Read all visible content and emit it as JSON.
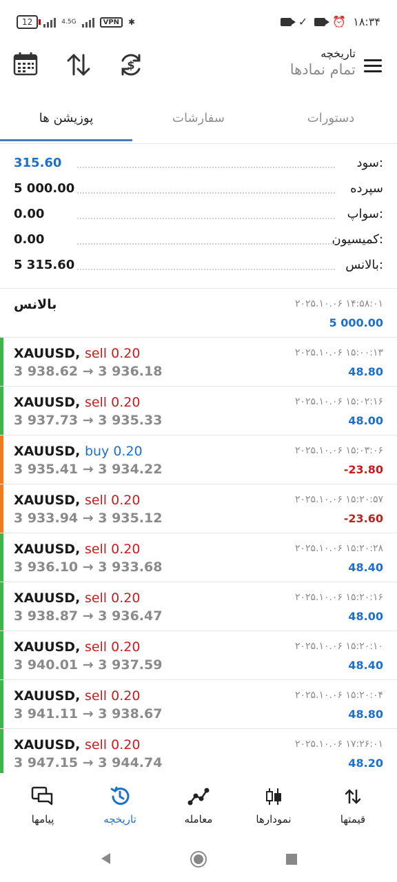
{
  "status_bar": {
    "battery": "12",
    "network_label": "4.5G",
    "vpn_label": "VPN",
    "time": "۱۸:۳۴"
  },
  "header": {
    "title": "تاریخچه",
    "subtitle": "تمام نمادها",
    "icons": [
      "calendar-icon",
      "sort-icon",
      "exchange-icon",
      "menu-icon"
    ]
  },
  "tabs": [
    {
      "label": "دستورات"
    },
    {
      "label": "سفارشات"
    },
    {
      "label": "پوزیشن ها",
      "active": true
    }
  ],
  "summary": [
    {
      "label": "سود:",
      "value": "315.60",
      "accent": true
    },
    {
      "label": "سپرده",
      "value": "5 000.00"
    },
    {
      "label": "سواپ:",
      "value": "0.00"
    },
    {
      "label": "کمیسیون:",
      "value": "0.00"
    },
    {
      "label": "بالانس:",
      "value": "5 315.60"
    }
  ],
  "balance_entry": {
    "title": "بالانس",
    "time": "۲۰۲۵.۱۰.۰۶ ۱۴:۵۸:۰۱",
    "amount": "5 000.00"
  },
  "deals": [
    {
      "symbol": "XAUUSD,",
      "side": "sell 0.20",
      "prices": "3 938.62 → 3 936.18",
      "time": "۲۰۲۵.۱۰.۰۶ ۱۵:۰۰:۱۳",
      "profit": "48.80"
    },
    {
      "symbol": "XAUUSD,",
      "side": "sell 0.20",
      "prices": "3 937.73 → 3 935.33",
      "time": "۲۰۲۵.۱۰.۰۶ ۱۵:۰۲:۱۶",
      "profit": "48.00"
    },
    {
      "symbol": "XAUUSD,",
      "side": "buy 0.20",
      "prices": "3 935.41 → 3 934.22",
      "time": "۲۰۲۵.۱۰.۰۶ ۱۵:۰۳:۰۶",
      "profit": "-23.80"
    },
    {
      "symbol": "XAUUSD,",
      "side": "sell 0.20",
      "prices": "3 933.94 → 3 935.12",
      "time": "۲۰۲۵.۱۰.۰۶ ۱۵:۲۰:۵۷",
      "profit": "-23.60"
    },
    {
      "symbol": "XAUUSD,",
      "side": "sell 0.20",
      "prices": "3 936.10 → 3 933.68",
      "time": "۲۰۲۵.۱۰.۰۶ ۱۵:۲۰:۲۸",
      "profit": "48.40"
    },
    {
      "symbol": "XAUUSD,",
      "side": "sell 0.20",
      "prices": "3 938.87 → 3 936.47",
      "time": "۲۰۲۵.۱۰.۰۶ ۱۵:۲۰:۱۶",
      "profit": "48.00"
    },
    {
      "symbol": "XAUUSD,",
      "side": "sell 0.20",
      "prices": "3 940.01 → 3 937.59",
      "time": "۲۰۲۵.۱۰.۰۶ ۱۵:۲۰:۱۰",
      "profit": "48.40"
    },
    {
      "symbol": "XAUUSD,",
      "side": "sell 0.20",
      "prices": "3 941.11 → 3 938.67",
      "time": "۲۰۲۵.۱۰.۰۶ ۱۵:۲۰:۰۴",
      "profit": "48.80"
    },
    {
      "symbol": "XAUUSD,",
      "side": "sell 0.20",
      "prices": "3 947.15 → 3 944.74",
      "time": "۲۰۲۵.۱۰.۰۶ ۱۷:۲۶:۰۱",
      "profit": "48.20"
    }
  ],
  "colors": {
    "accent": "#1d6fcf",
    "sell": "#c41e1e",
    "buy": "#1d6fcf",
    "loss": "#c41e1e",
    "profit_bar": "#3cb54a",
    "loss_bar": "#f27b20"
  },
  "bottom_nav": [
    {
      "label": "قیمتها",
      "icon": "quotes-icon"
    },
    {
      "label": "نمودارها",
      "icon": "chart-icon"
    },
    {
      "label": "معامله",
      "icon": "trade-icon"
    },
    {
      "label": "تاریخچه",
      "icon": "history-icon",
      "active": true
    },
    {
      "label": "پیامها",
      "icon": "messages-icon"
    }
  ]
}
